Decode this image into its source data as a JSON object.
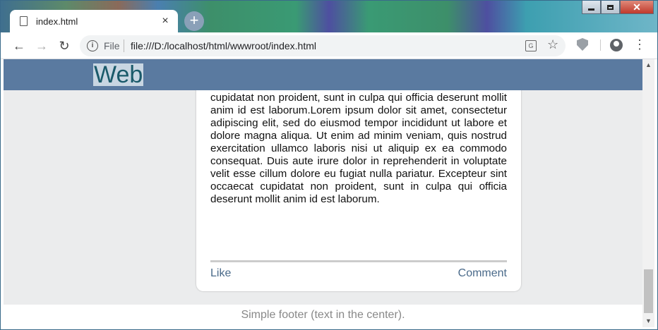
{
  "browser": {
    "tab_title": "index.html",
    "tab_close": "×",
    "new_tab": "+",
    "scheme_label": "File",
    "url": "file:///D:/localhost/html/wwwroot/index.html",
    "icons": [
      "page-icon",
      "back-icon",
      "forward-icon",
      "reload-icon",
      "info-icon",
      "translate-icon",
      "star-icon",
      "extension-shield-icon",
      "account-icon",
      "menu-icon"
    ]
  },
  "window_controls": {
    "minimize": "minimize",
    "maximize": "maximize",
    "close": "close"
  },
  "page": {
    "logo": "Web",
    "card_text": "ullamco laboris nisi ut aliquip ex ea commodo consequat. Duis aute irure dolor in reprehenderit in voluptate velit esse cillum dolore eu fugiat nulla pariatur. Excepteur sint occaecat cupidatat non proident, sunt in culpa qui officia deserunt mollit anim id est laborum.Lorem ipsum dolor sit amet, consectetur adipiscing elit, sed do eiusmod tempor incididunt ut labore et dolore magna aliqua. Ut enim ad minim veniam, quis nostrud exercitation ullamco laboris nisi ut aliquip ex ea commodo consequat. Duis aute irure dolor in reprehenderit in voluptate velit esse cillum dolore eu fugiat nulla pariatur. Excepteur sint occaecat cupidatat non proident, sunt in culpa qui officia deserunt mollit anim id est laborum.",
    "like_label": "Like",
    "comment_label": "Comment",
    "footer_text": "Simple footer (text in the center)."
  },
  "colors": {
    "header": "#5a7aa0",
    "page_background": "#ebeced",
    "link": "#4a6a8a"
  }
}
